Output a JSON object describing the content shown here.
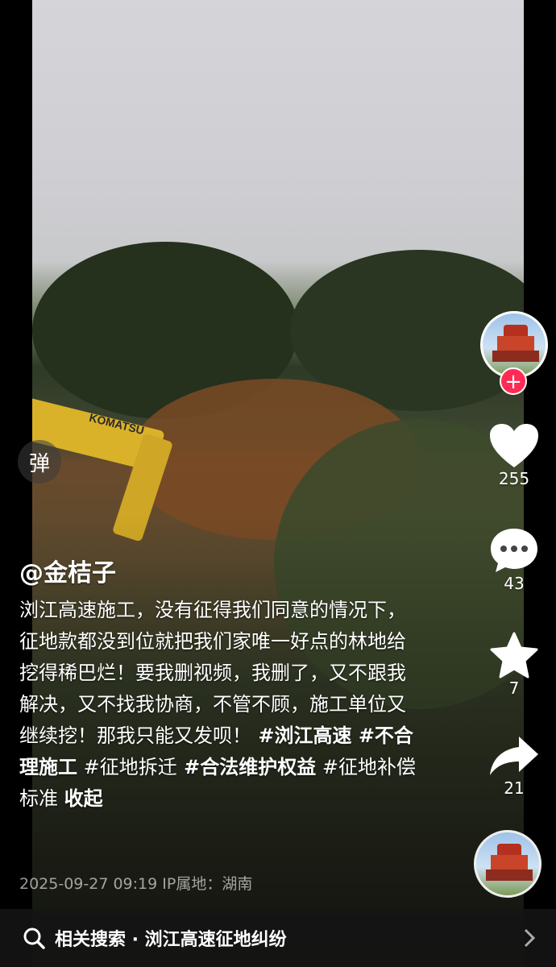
{
  "danmaku": {
    "label": "弹"
  },
  "author": {
    "handle": "@金桔子"
  },
  "description": {
    "text_parts": [
      {
        "t": "浏江高速施工，没有征得我们同意的情况下，征地款都没到位就把我们家唯一好点的林地给挖得稀巴烂！要我删视频，我删了，又不跟我解决，又不找我协商，不管不顾，施工单位又继续挖！那我只能又发呗！",
        "cls": ""
      },
      {
        "t": " #浏江高速",
        "cls": "tag"
      },
      {
        "t": " #不合理施工",
        "cls": "tag"
      },
      {
        "t": " #征地拆迁",
        "cls": "tag-light"
      },
      {
        "t": " #合法维护权益",
        "cls": "tag"
      },
      {
        "t": " #征地补偿标准",
        "cls": "tag-light"
      }
    ],
    "collapse_label": "收起"
  },
  "meta": {
    "timestamp": "2025-09-27 09:19",
    "ip_location": "IP属地：湖南"
  },
  "rail": {
    "likes": "255",
    "comments": "43",
    "favorites": "7",
    "shares": "21",
    "follow_label": "+"
  },
  "related_search": {
    "label": "相关搜索 · 浏江高速征地纠纷"
  },
  "scene": {
    "excavator_brand": "KOMATSU"
  },
  "colors": {
    "follow_button": "#ff2b54",
    "excavator": "#d9b22a"
  },
  "icons": [
    "heart-icon",
    "comment-icon",
    "star-icon",
    "share-icon",
    "search-icon",
    "chevron-right-icon"
  ]
}
